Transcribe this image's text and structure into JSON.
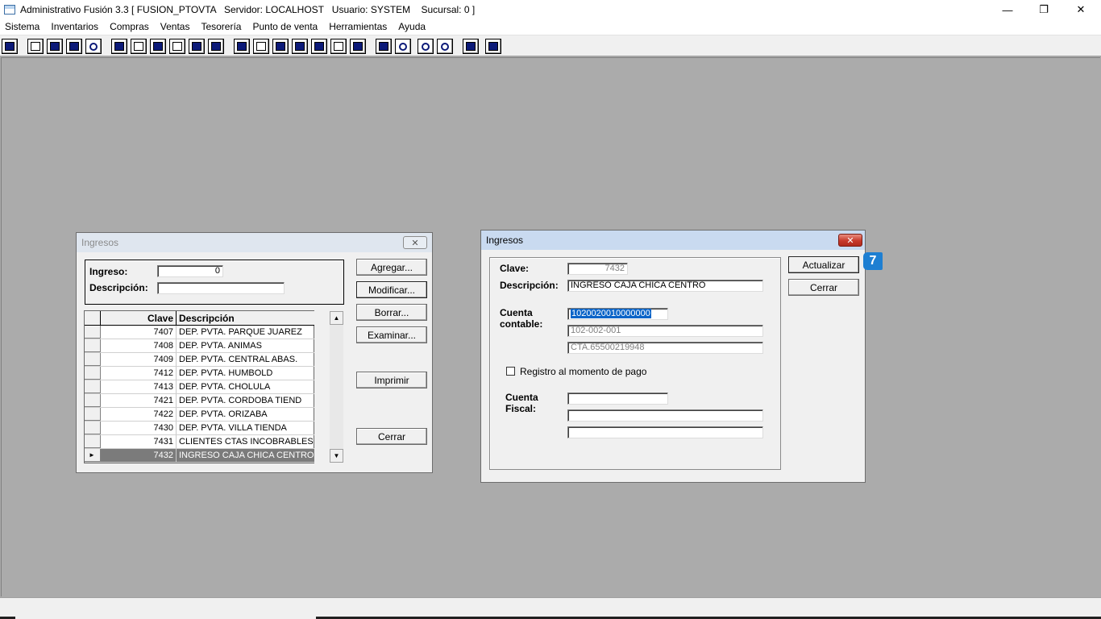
{
  "window": {
    "title": "Administrativo Fusión 3.3 [ FUSION_PTOVTA   Servidor: LOCALHOST   Usuario: SYSTEM    Sucursal: 0 ]",
    "minimize": "—",
    "restore": "❐",
    "close": "✕"
  },
  "menu": [
    "Sistema",
    "Inventarios",
    "Compras",
    "Ventas",
    "Tesorería",
    "Punto de venta",
    "Herramientas",
    "Ayuda"
  ],
  "toolbar_icons": [
    "calculator-icon",
    "copy-icon",
    "clipboard-icon",
    "transfer-icon",
    "zoom-icon",
    "user-icon",
    "folder-icon",
    "export-icon",
    "print-icon",
    "document-icon",
    "list-icon",
    "people-icon",
    "card-icon",
    "send-icon",
    "add-icon",
    "dollar-icon",
    "report-icon",
    "table-icon",
    "home-icon",
    "search-icon",
    "refresh-icon",
    "undo-icon",
    "back-icon",
    "help-icon"
  ],
  "list_dialog": {
    "title": "Ingresos",
    "close": "✕",
    "ingreso_label": "Ingreso:",
    "ingreso_value": "0",
    "descripcion_label": "Descripción:",
    "descripcion_value": "",
    "columns": [
      "Clave",
      "Descripción"
    ],
    "rows": [
      {
        "clave": "7407",
        "descripcion": "DEP. PVTA. PARQUE JUAREZ"
      },
      {
        "clave": "7408",
        "descripcion": "DEP. PVTA. ANIMAS"
      },
      {
        "clave": "7409",
        "descripcion": "DEP. PVTA. CENTRAL ABAS."
      },
      {
        "clave": "7412",
        "descripcion": "DEP. PVTA. HUMBOLD"
      },
      {
        "clave": "7413",
        "descripcion": "DEP. PVTA. CHOLULA"
      },
      {
        "clave": "7421",
        "descripcion": "DEP. PVTA. CORDOBA TIEND"
      },
      {
        "clave": "7422",
        "descripcion": "DEP. PVTA. ORIZABA"
      },
      {
        "clave": "7430",
        "descripcion": "DEP. PVTA. VILLA TIENDA"
      },
      {
        "clave": "7431",
        "descripcion": "CLIENTES CTAS INCOBRABLES"
      },
      {
        "clave": "7432",
        "descripcion": "INGRESO CAJA CHICA CENTRO"
      }
    ],
    "current_row_marker": "►",
    "scroll_up": "▲",
    "scroll_down": "▼",
    "buttons": {
      "agregar": "Agregar...",
      "modificar": "Modificar...",
      "borrar": "Borrar...",
      "examinar": "Examinar...",
      "imprimir": "Imprimir",
      "cerrar": "Cerrar"
    }
  },
  "edit_dialog": {
    "title": "Ingresos",
    "close": "✕",
    "clave_label": "Clave:",
    "clave_value": "7432",
    "descripcion_label": "Descripción:",
    "descripcion_value": "INGRESO CAJA CHICA CENTRO",
    "cuenta_contable_label_1": "Cuenta",
    "cuenta_contable_label_2": "contable:",
    "cuenta_contable_value": "1020020010000000",
    "cuenta_contable_code": "102-002-001",
    "cuenta_contable_name": "CTA.65500219948",
    "registro_label": "Registro al momento de pago",
    "registro_checked": false,
    "cuenta_fiscal_label_1": "Cuenta",
    "cuenta_fiscal_label_2": "Fiscal:",
    "cuenta_fiscal_value": "",
    "cuenta_fiscal_code": "",
    "cuenta_fiscal_name": "",
    "buttons": {
      "actualizar": "Actualizar",
      "cerrar": "Cerrar"
    },
    "badge": "7"
  }
}
